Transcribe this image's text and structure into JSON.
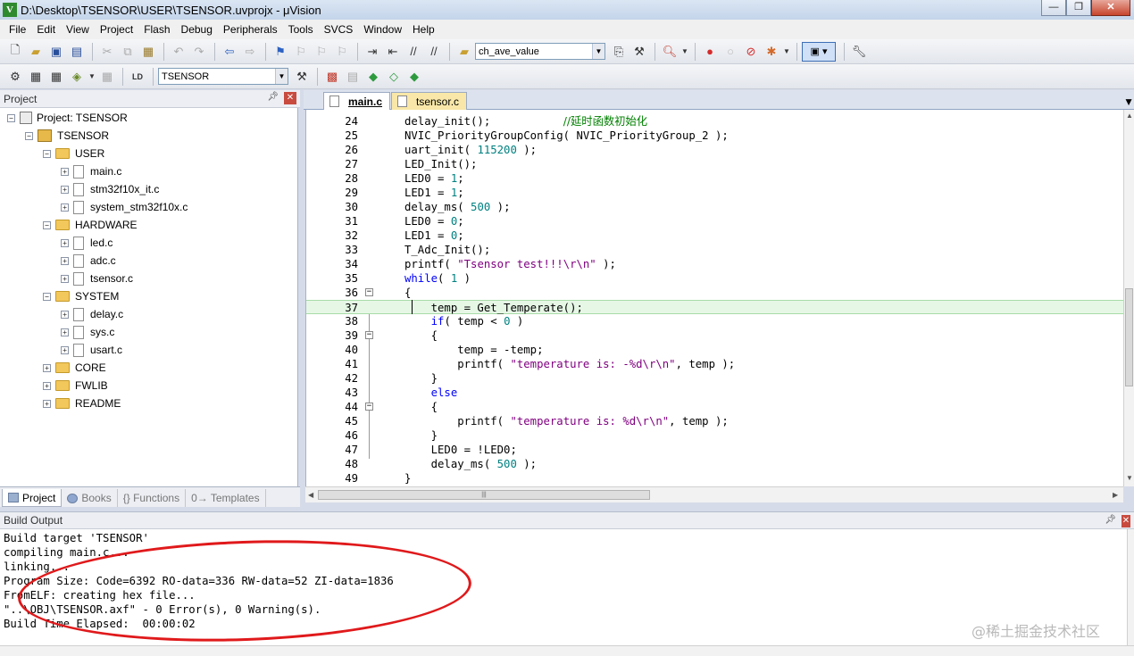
{
  "window": {
    "title": "D:\\Desktop\\TSENSOR\\USER\\TSENSOR.uvprojx - μVision",
    "app_icon": "V"
  },
  "menu": [
    "File",
    "Edit",
    "View",
    "Project",
    "Flash",
    "Debug",
    "Peripherals",
    "Tools",
    "SVCS",
    "Window",
    "Help"
  ],
  "toolbar": {
    "find_combo_value": "ch_ave_value",
    "target_combo_value": "TSENSOR"
  },
  "project_pane": {
    "title": "Project",
    "tree": [
      {
        "label": "Project: TSENSOR",
        "icon": "project-icon",
        "level": 0,
        "expander": "−"
      },
      {
        "label": "TSENSOR",
        "icon": "target-icon",
        "level": 1,
        "expander": "−"
      },
      {
        "label": "USER",
        "icon": "folder-icon",
        "level": 2,
        "expander": "−"
      },
      {
        "label": "main.c",
        "icon": "file-icon",
        "level": 3,
        "expander": "+"
      },
      {
        "label": "stm32f10x_it.c",
        "icon": "file-icon",
        "level": 3,
        "expander": "+"
      },
      {
        "label": "system_stm32f10x.c",
        "icon": "file-icon",
        "level": 3,
        "expander": "+"
      },
      {
        "label": "HARDWARE",
        "icon": "folder-icon",
        "level": 2,
        "expander": "−"
      },
      {
        "label": "led.c",
        "icon": "file-icon",
        "level": 3,
        "expander": "+"
      },
      {
        "label": "adc.c",
        "icon": "file-icon",
        "level": 3,
        "expander": "+"
      },
      {
        "label": "tsensor.c",
        "icon": "file-icon",
        "level": 3,
        "expander": "+"
      },
      {
        "label": "SYSTEM",
        "icon": "folder-icon",
        "level": 2,
        "expander": "−"
      },
      {
        "label": "delay.c",
        "icon": "file-icon",
        "level": 3,
        "expander": "+"
      },
      {
        "label": "sys.c",
        "icon": "file-icon",
        "level": 3,
        "expander": "+"
      },
      {
        "label": "usart.c",
        "icon": "file-icon",
        "level": 3,
        "expander": "+"
      },
      {
        "label": "CORE",
        "icon": "folder-icon",
        "level": 2,
        "expander": "+"
      },
      {
        "label": "FWLIB",
        "icon": "folder-icon",
        "level": 2,
        "expander": "+"
      },
      {
        "label": "README",
        "icon": "folder-icon",
        "level": 2,
        "expander": "+"
      }
    ],
    "tabs": [
      "Project",
      "Books",
      "{} Functions",
      "0→ Templates"
    ]
  },
  "editor": {
    "tabs": [
      {
        "label": "main.c",
        "active": true
      },
      {
        "label": "tsensor.c",
        "active": false
      }
    ],
    "current_line": 37,
    "lines": [
      {
        "n": "24",
        "code": "delay_init();",
        "comment": "//延时函数初始化"
      },
      {
        "n": "25",
        "code": "NVIC_PriorityGroupConfig( NVIC_PriorityGroup_2 );"
      },
      {
        "n": "26",
        "code": "uart_init( 115200 );"
      },
      {
        "n": "27",
        "code": "LED_Init();"
      },
      {
        "n": "28",
        "code": "LED0 = 1;"
      },
      {
        "n": "29",
        "code": "LED1 = 1;"
      },
      {
        "n": "30",
        "code": "delay_ms( 500 );"
      },
      {
        "n": "31",
        "code": "LED0 = 0;"
      },
      {
        "n": "32",
        "code": "LED1 = 0;"
      },
      {
        "n": "33",
        "code": "T_Adc_Init();"
      },
      {
        "n": "34",
        "code": "printf( \"Tsensor test!!!\\r\\n\" );"
      },
      {
        "n": "35",
        "code": "while( 1 )"
      },
      {
        "n": "36",
        "code": "{",
        "fold": "−"
      },
      {
        "n": "37",
        "code": "    temp = Get_Temperate();"
      },
      {
        "n": "38",
        "code": "    if( temp < 0 )"
      },
      {
        "n": "39",
        "code": "    {",
        "fold": "−"
      },
      {
        "n": "40",
        "code": "        temp = -temp;"
      },
      {
        "n": "41",
        "code": "        printf( \"temperature is: -%d\\r\\n\", temp );"
      },
      {
        "n": "42",
        "code": "    }"
      },
      {
        "n": "43",
        "code": "    else"
      },
      {
        "n": "44",
        "code": "    {",
        "fold": "−"
      },
      {
        "n": "45",
        "code": "        printf( \"temperature is: %d\\r\\n\", temp );"
      },
      {
        "n": "46",
        "code": "    }"
      },
      {
        "n": "47",
        "code": "    LED0 = !LED0;"
      },
      {
        "n": "48",
        "code": "    delay_ms( 500 );"
      },
      {
        "n": "49",
        "code": "}"
      }
    ]
  },
  "build_output": {
    "title": "Build Output",
    "lines": [
      "Build target 'TSENSOR'",
      "compiling main.c...",
      "linking...",
      "Program Size: Code=6392 RO-data=336 RW-data=52 ZI-data=1836",
      "FromELF: creating hex file...",
      "\"..\\OBJ\\TSENSOR.axf\" - 0 Error(s), 0 Warning(s).",
      "Build Time Elapsed:  00:00:02"
    ],
    "annotation_color": "#e0191b"
  },
  "watermark": "@稀土掘金技术社区",
  "colors": {
    "keyword": "#0000ff",
    "string": "#800080",
    "number": "#008080",
    "comment": "#008000",
    "current_line": "#e6f7e6"
  }
}
